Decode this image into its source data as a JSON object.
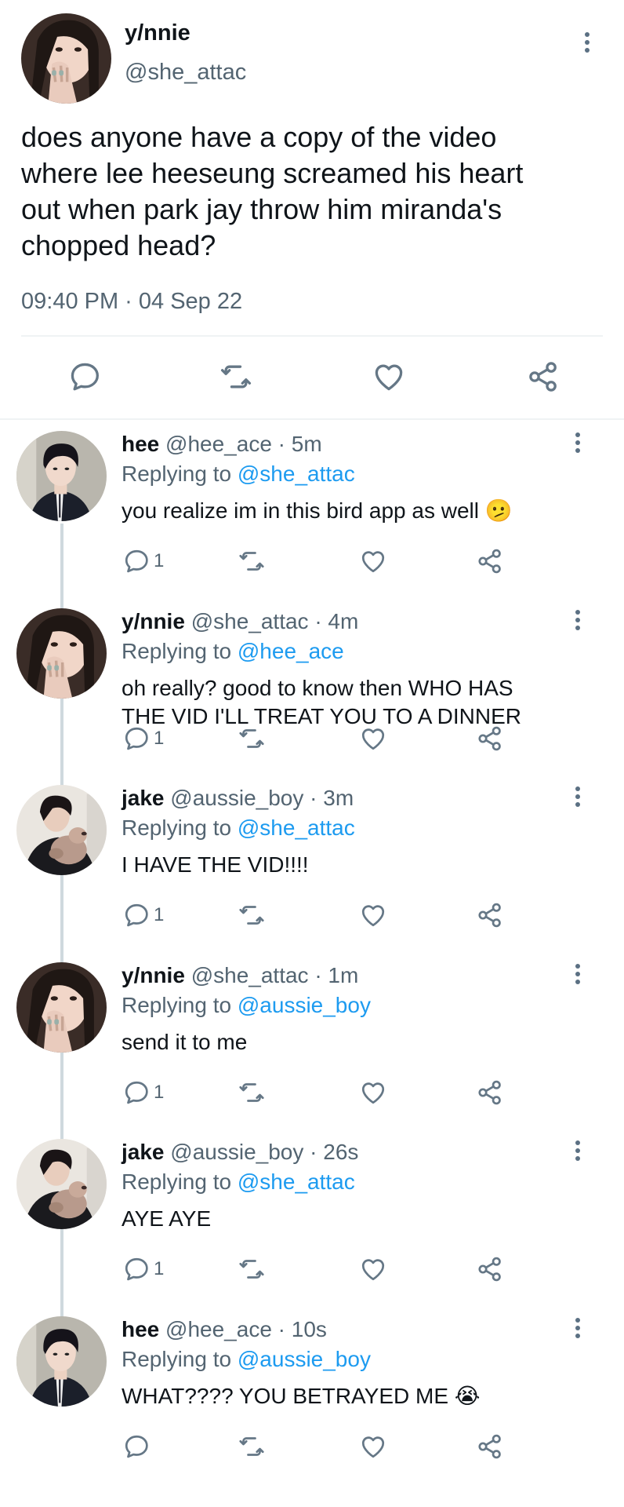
{
  "main_tweet": {
    "name": "y/nnie",
    "handle": "@she_attac",
    "text_lines": [
      "does anyone have a copy of the video",
      "where lee heeseung screamed his heart",
      "out when park jay throw him miranda's",
      "chopped head?"
    ],
    "timestamp": "09:40 PM · 04 Sep 22"
  },
  "replies": [
    {
      "name": "hee",
      "handle": "@hee_ace",
      "time": "· 5m",
      "replying_label": "Replying to",
      "replying_to": "@she_attac",
      "text": "you realize im in this bird app as well",
      "emoji": "🫤",
      "reply_count": "1",
      "avatar": "hee"
    },
    {
      "name": "y/nnie",
      "handle": "@she_attac",
      "time": "· 4m",
      "replying_label": "Replying to",
      "replying_to": "@hee_ace",
      "text": "oh really? good to know then WHO HAS\nTHE VID I'LL TREAT YOU TO A DINNER",
      "emoji": "",
      "reply_count": "1",
      "avatar": "ynnie"
    },
    {
      "name": "jake",
      "handle": "@aussie_boy",
      "time": "· 3m",
      "replying_label": "Replying to",
      "replying_to": "@she_attac",
      "text": "I HAVE THE VID!!!!",
      "emoji": "",
      "reply_count": "1",
      "avatar": "jake"
    },
    {
      "name": "y/nnie",
      "handle": "@she_attac",
      "time": "· 1m",
      "replying_label": "Replying to",
      "replying_to": "@aussie_boy",
      "text": "send it to me",
      "emoji": "",
      "reply_count": "1",
      "avatar": "ynnie"
    },
    {
      "name": "jake",
      "handle": "@aussie_boy",
      "time": "· 26s",
      "replying_label": "Replying to",
      "replying_to": "@she_attac",
      "text": "AYE AYE",
      "emoji": "",
      "reply_count": "1",
      "avatar": "jake"
    },
    {
      "name": "hee",
      "handle": "@hee_ace",
      "time": "· 10s",
      "replying_label": "Replying to",
      "replying_to": "@aussie_boy",
      "text": "WHAT???? YOU BETRAYED ME",
      "emoji": "😭",
      "reply_count": "",
      "avatar": "hee"
    }
  ],
  "icons": {
    "reply": "reply-icon",
    "retweet": "retweet-icon",
    "like": "heart-icon",
    "share": "share-icon",
    "more": "more-vertical-icon"
  },
  "colors": {
    "text": "#0f1419",
    "secondary": "#536471",
    "link": "#1d9bf0",
    "icon": "#657786",
    "divider": "#eff3f4"
  }
}
